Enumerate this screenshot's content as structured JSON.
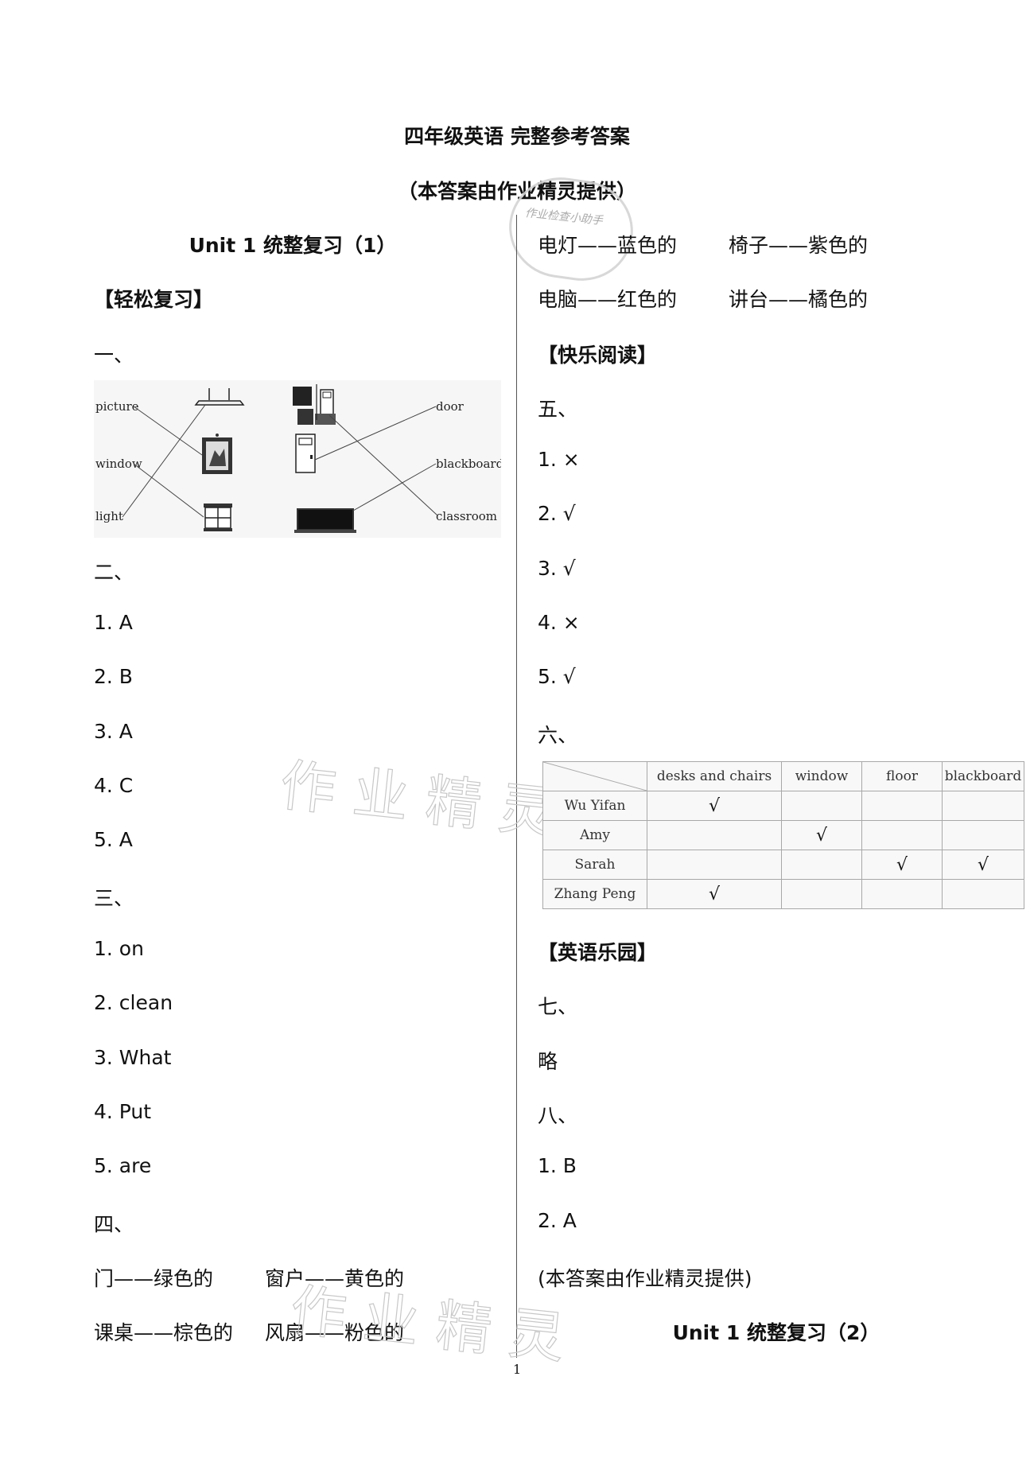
{
  "header": {
    "title": "四年级英语  完整参考答案",
    "subtitle": "（本答案由作业精灵提供）"
  },
  "watermark": {
    "stamp_text": "作业检查小助手",
    "large_text": "作业精灵"
  },
  "left_column": {
    "unit_title": "Unit 1  统整复习（1）",
    "section_easy_review": "【轻松复习】",
    "q1": {
      "label": "一、",
      "figure": {
        "left_words": [
          "picture",
          "window",
          "light"
        ],
        "right_words": [
          "door",
          "blackboard",
          "classroom"
        ],
        "left_images": [
          "light-fixture",
          "picture-frame",
          "window"
        ],
        "right_images": [
          "classroom",
          "door",
          "blackboard"
        ],
        "matches": [
          {
            "word": "picture",
            "image": "picture-frame"
          },
          {
            "word": "window",
            "image": "window"
          },
          {
            "word": "light",
            "image": "light-fixture"
          },
          {
            "word": "door",
            "image": "door"
          },
          {
            "word": "blackboard",
            "image": "blackboard"
          },
          {
            "word": "classroom",
            "image": "classroom"
          }
        ]
      }
    },
    "q2": {
      "label": "二、",
      "answers": [
        "1.  A",
        "2.  B",
        "3.  A",
        "4.  C",
        "5.  A"
      ]
    },
    "q3": {
      "label": "三、",
      "answers": [
        "1.  on",
        "2.  clean",
        "3.  What",
        "4.  Put",
        "5.  are"
      ]
    },
    "q4": {
      "label": "四、",
      "pairs": [
        [
          "门——绿色的",
          "窗户——黄色的"
        ],
        [
          "课桌——棕色的",
          "风扇——粉色的"
        ]
      ]
    }
  },
  "right_column": {
    "q4_continued": [
      [
        "电灯——蓝色的",
        "椅子——紫色的"
      ],
      [
        "电脑——红色的",
        "讲台——橘色的"
      ]
    ],
    "section_happy_reading": "【快乐阅读】",
    "q5": {
      "label": "五、",
      "answers": [
        "1.  ×",
        "2.  √",
        "3.  √",
        "4.  ×",
        "5.  √"
      ]
    },
    "q6": {
      "label": "六、",
      "table": {
        "columns": [
          "desks and chairs",
          "window",
          "floor",
          "blackboard"
        ],
        "rows": [
          {
            "name": "Wu Yifan",
            "cells": [
              "√",
              "",
              "",
              ""
            ]
          },
          {
            "name": "Amy",
            "cells": [
              "",
              "√",
              "",
              ""
            ]
          },
          {
            "name": "Sarah",
            "cells": [
              "",
              "",
              "√",
              "√"
            ]
          },
          {
            "name": "Zhang Peng",
            "cells": [
              "√",
              "",
              "",
              ""
            ]
          }
        ]
      }
    },
    "section_english_park": "【英语乐园】",
    "q7": {
      "label": "七、",
      "answer": "略"
    },
    "q8": {
      "label": "八、",
      "answers": [
        "1.  B",
        "2.  A"
      ]
    },
    "footer_note": "(本答案由作业精灵提供)",
    "next_unit_title": "Unit 1  统整复习（2）"
  },
  "page_number": "1"
}
